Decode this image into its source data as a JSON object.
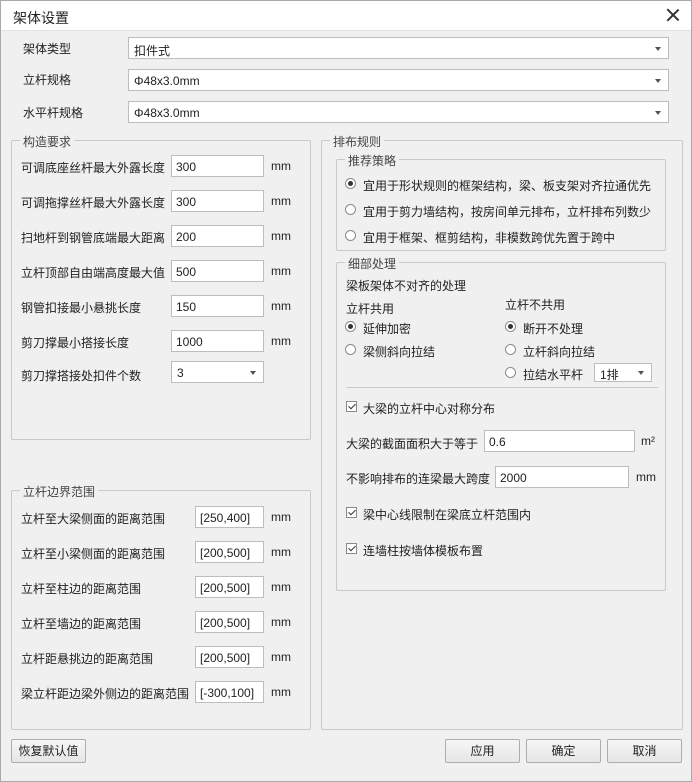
{
  "window": {
    "title": "架体设置"
  },
  "top": {
    "frame_type": {
      "label": "架体类型",
      "value": "扣件式"
    },
    "vertical_spec": {
      "label": "立杆规格",
      "value": "Φ48x3.0mm"
    },
    "horizontal_spec": {
      "label": "水平杆规格",
      "value": "Φ48x3.0mm"
    }
  },
  "construction": {
    "title": "构造要求",
    "rows": [
      {
        "label": "可调底座丝杆最大外露长度",
        "value": "300",
        "unit": "mm"
      },
      {
        "label": "可调拖撑丝杆最大外露长度",
        "value": "300",
        "unit": "mm"
      },
      {
        "label": "扫地杆到钢管底端最大距离",
        "value": "200",
        "unit": "mm"
      },
      {
        "label": "立杆顶部自由端高度最大值",
        "value": "500",
        "unit": "mm"
      },
      {
        "label": "钢管扣接最小悬挑长度",
        "value": "150",
        "unit": "mm"
      },
      {
        "label": "剪刀撑最小搭接长度",
        "value": "1000",
        "unit": "mm"
      }
    ],
    "clamp_count": {
      "label": "剪刀撑搭接处扣件个数",
      "value": "3"
    }
  },
  "boundary": {
    "title": "立杆边界范围",
    "rows": [
      {
        "label": "立杆至大梁侧面的距离范围",
        "value": "[250,400]",
        "unit": "mm"
      },
      {
        "label": "立杆至小梁侧面的距离范围",
        "value": "[200,500]",
        "unit": "mm"
      },
      {
        "label": "立杆至柱边的距离范围",
        "value": "[200,500]",
        "unit": "mm"
      },
      {
        "label": "立杆至墙边的距离范围",
        "value": "[200,500]",
        "unit": "mm"
      },
      {
        "label": "立杆距悬挑边的距离范围",
        "value": "[200,500]",
        "unit": "mm"
      },
      {
        "label": "梁立杆距边梁外侧边的距离范围",
        "value": "[-300,100]",
        "unit": "mm"
      }
    ]
  },
  "layout_rules": {
    "title": "排布规则",
    "strategy": {
      "title": "推荐策略",
      "options": [
        {
          "label": "宜用于形状规则的框架结构，梁、板支架对齐拉通优先",
          "selected": true
        },
        {
          "label": "宜用于剪力墙结构，按房间单元排布，立杆排布列数少",
          "selected": false
        },
        {
          "label": "宜用于框架、框剪结构，非模数跨优先置于跨中",
          "selected": false
        }
      ]
    },
    "detail": {
      "title": "细部处理",
      "misaligned_label": "梁板架体不对齐的处理",
      "shared": {
        "title": "立杆共用",
        "options": [
          {
            "label": "延伸加密",
            "selected": true
          },
          {
            "label": "梁侧斜向拉结",
            "selected": false
          }
        ]
      },
      "not_shared": {
        "title": "立杆不共用",
        "options": [
          {
            "label": "断开不处理",
            "selected": true
          },
          {
            "label": "立杆斜向拉结",
            "selected": false
          },
          {
            "label": "拉结水平杆",
            "selected": false
          }
        ],
        "rows_select": "1排"
      },
      "symmetric": {
        "label": "大梁的立杆中心对称分布",
        "checked": true
      },
      "section_area": {
        "label": "大梁的截面面积大于等于",
        "value": "0.6",
        "unit": "m²"
      },
      "max_span": {
        "label": "不影响排布的连梁最大跨度",
        "value": "2000",
        "unit": "mm"
      },
      "centerline_limit": {
        "label": "梁中心线限制在梁底立杆范围内",
        "checked": true
      },
      "wall_column": {
        "label": "连墙柱按墙体模板布置",
        "checked": true
      }
    }
  },
  "buttons": {
    "restore": "恢复默认值",
    "apply": "应用",
    "ok": "确定",
    "cancel": "取消"
  }
}
